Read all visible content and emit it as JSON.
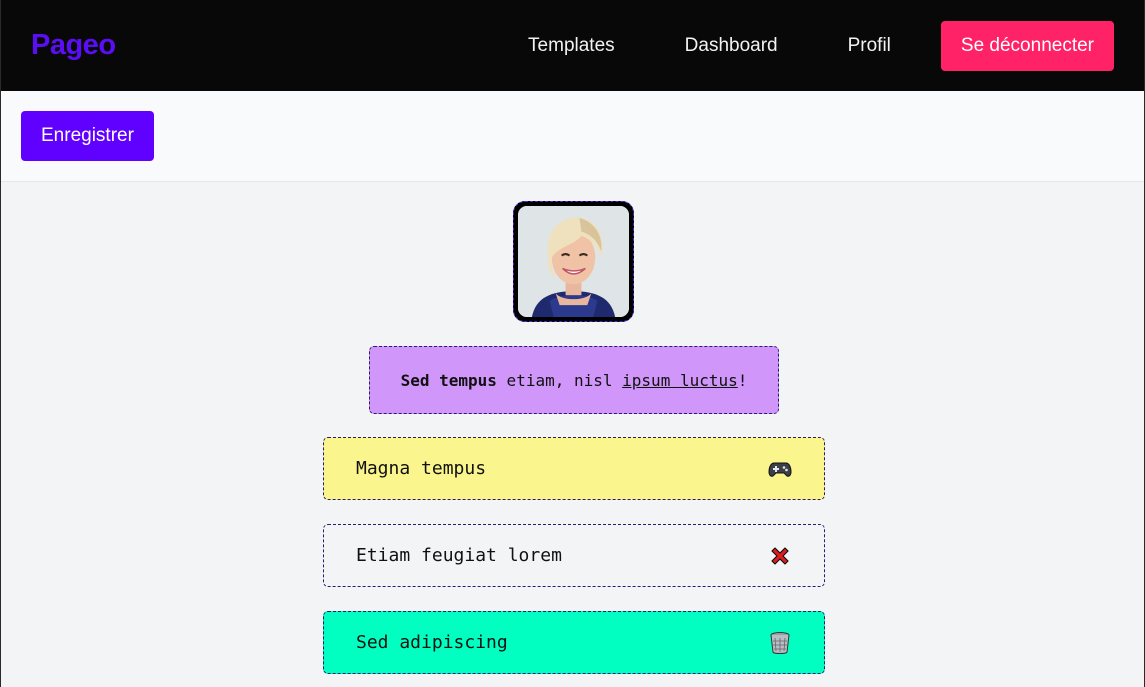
{
  "navbar": {
    "logo": "Pageo",
    "links": [
      "Templates",
      "Dashboard",
      "Profil"
    ],
    "logout_label": "Se déconnecter"
  },
  "toolbar": {
    "save_label": "Enregistrer"
  },
  "profile": {
    "bio_bold": "Sed tempus",
    "bio_text": " etiam, nisl ",
    "bio_link": "ipsum luctus",
    "bio_end": "!"
  },
  "links": [
    {
      "label": "Magna tempus",
      "icon": "gamepad-icon",
      "bg": "#faf58c"
    },
    {
      "label": "Etiam feugiat lorem",
      "icon": "cross-mark-icon",
      "bg": "#f3f4f6"
    },
    {
      "label": "Sed adipiscing",
      "icon": "wastebasket-icon",
      "bg": "#00ffc0"
    }
  ],
  "colors": {
    "logo": "#5b0df5",
    "logout": "#ff2266",
    "save": "#6000ff",
    "navbar_bg": "#080808"
  }
}
